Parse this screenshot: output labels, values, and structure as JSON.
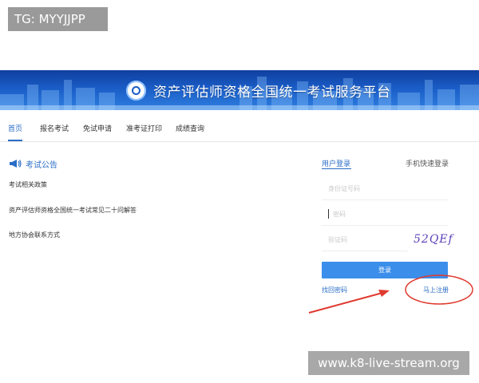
{
  "badge": {
    "text": "TG: MYYJJPP"
  },
  "header": {
    "title": "资产评估师资格全国统一考试服务平台",
    "logo_icon": "emblem-icon"
  },
  "nav": {
    "items": [
      {
        "label": "首页",
        "active": true
      },
      {
        "label": "报名考试"
      },
      {
        "label": "免试申请"
      },
      {
        "label": "准考证打印"
      },
      {
        "label": "成绩查询"
      }
    ]
  },
  "notices": {
    "title": "考试公告",
    "icon": "megaphone-icon",
    "items": [
      {
        "label": "考试相关政策"
      },
      {
        "label": "资产评估师资格全国统一考试常见二十问解答"
      },
      {
        "label": "地方协会联系方式"
      }
    ]
  },
  "login": {
    "tabs": [
      {
        "label": "用户登录",
        "active": true
      },
      {
        "label": "手机快速登录"
      }
    ],
    "username_placeholder": "身份证号码",
    "password_placeholder": "密码",
    "captcha_placeholder": "验证码",
    "captcha_text": "52QEf",
    "submit_label": "登录",
    "forgot_label": "找回密码",
    "register_label": "马上注册"
  },
  "colors": {
    "accent": "#2a6dc6",
    "button": "#3b8eea",
    "annotation": "#e03a2f"
  },
  "watermark": {
    "text": "www.k8-live-stream.org"
  }
}
